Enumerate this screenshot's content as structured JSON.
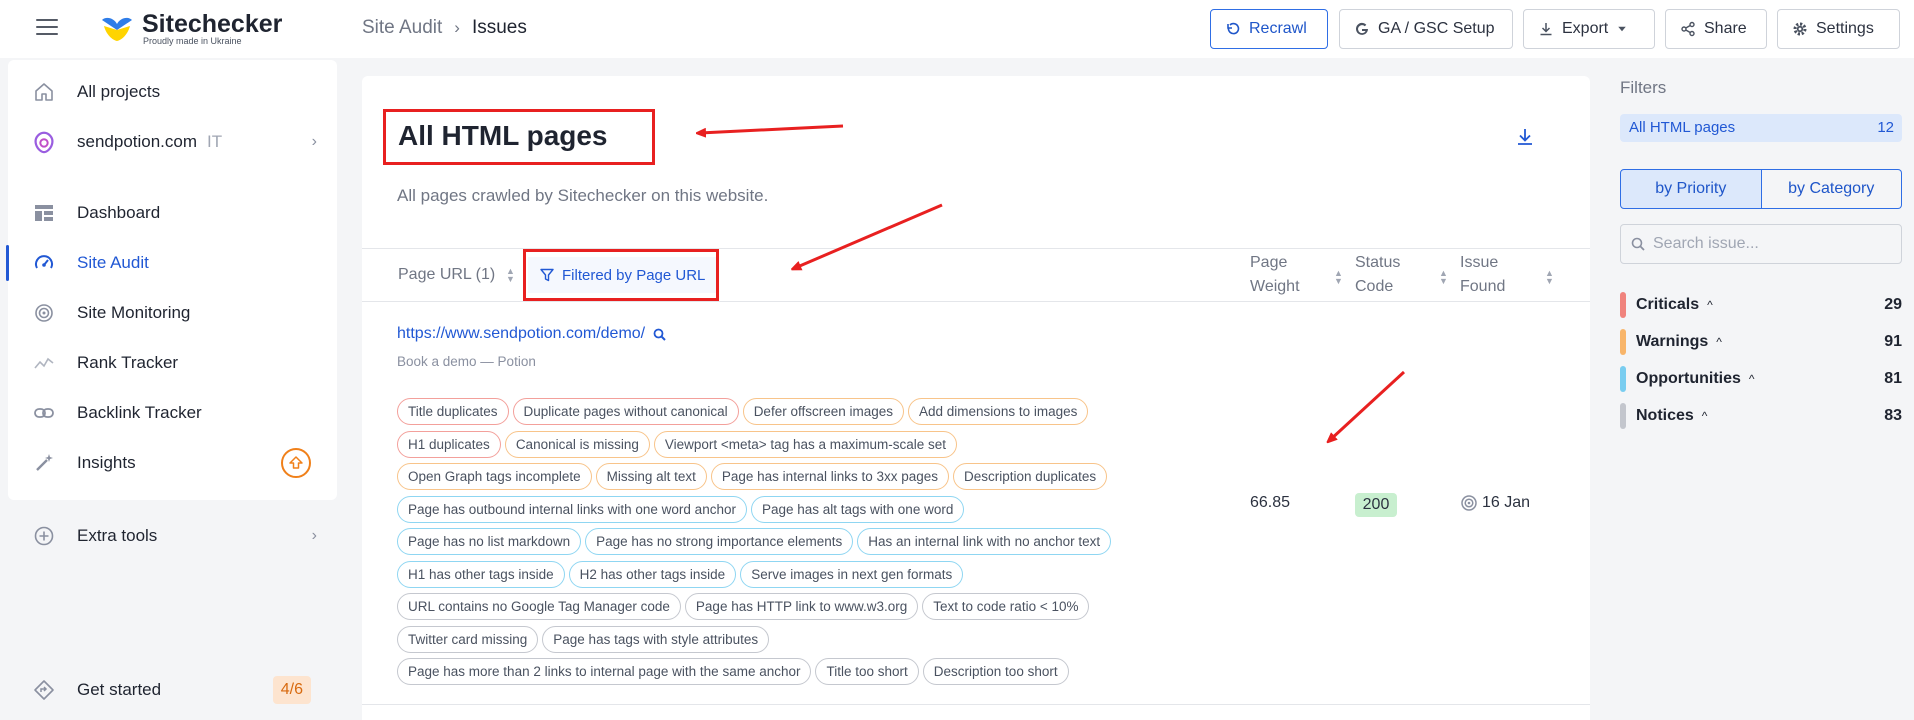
{
  "logo": {
    "name": "Sitechecker",
    "tagline": "Proudly made in Ukraine"
  },
  "breadcrumb": {
    "parent": "Site Audit",
    "separator": "›",
    "current": "Issues"
  },
  "toolbar": {
    "recrawl": "Recrawl",
    "ga_gsc": "GA / GSC Setup",
    "export": "Export",
    "share": "Share",
    "settings": "Settings"
  },
  "sidebar": {
    "all_projects": "All projects",
    "project_domain": "sendpotion.com",
    "project_tag": "IT",
    "items": [
      {
        "label": "Dashboard"
      },
      {
        "label": "Site Audit"
      },
      {
        "label": "Site Monitoring"
      },
      {
        "label": "Rank Tracker"
      },
      {
        "label": "Backlink Tracker"
      },
      {
        "label": "Insights"
      }
    ],
    "extra_tools": "Extra tools",
    "get_started": "Get started",
    "get_started_progress": "4/6"
  },
  "main": {
    "title": "All HTML pages",
    "description": "All pages crawled by Sitechecker on this website.",
    "columns": {
      "page_url": "Page URL (1)",
      "filter_chip": "Filtered by Page URL",
      "page_weight_1": "Page",
      "page_weight_2": "Weight",
      "status_code_1": "Status",
      "status_code_2": "Code",
      "issue_found_1": "Issue",
      "issue_found_2": "Found"
    },
    "row": {
      "url": "https://www.sendpotion.com/demo/",
      "page_title": "Book a demo — Potion",
      "page_weight": "66.85",
      "status_code": "200",
      "issue_found": "16 Jan"
    },
    "tag_lines": [
      [
        {
          "label": "Title duplicates",
          "level": "critical"
        },
        {
          "label": "Duplicate pages without canonical",
          "level": "critical"
        },
        {
          "label": "Defer offscreen images",
          "level": "warning"
        },
        {
          "label": "Add dimensions to images",
          "level": "warning"
        }
      ],
      [
        {
          "label": "H1 duplicates",
          "level": "critical"
        },
        {
          "label": "Canonical is missing",
          "level": "warning"
        },
        {
          "label": "Viewport <meta> tag has a maximum-scale set",
          "level": "warning"
        }
      ],
      [
        {
          "label": "Open Graph tags incomplete",
          "level": "warning"
        },
        {
          "label": "Missing alt text",
          "level": "warning"
        },
        {
          "label": "Page has internal links to 3xx pages",
          "level": "warning"
        },
        {
          "label": "Description duplicates",
          "level": "warning"
        }
      ],
      [
        {
          "label": "Page has outbound internal links with one word anchor",
          "level": "opportunity"
        },
        {
          "label": "Page has alt tags with one word",
          "level": "opportunity"
        }
      ],
      [
        {
          "label": "Page has no list markdown",
          "level": "opportunity"
        },
        {
          "label": "Page has no strong importance elements",
          "level": "opportunity"
        },
        {
          "label": "Has an internal link with no anchor text",
          "level": "opportunity"
        }
      ],
      [
        {
          "label": "H1 has other tags inside",
          "level": "opportunity"
        },
        {
          "label": "H2 has other tags inside",
          "level": "opportunity"
        },
        {
          "label": "Serve images in next gen formats",
          "level": "opportunity"
        }
      ],
      [
        {
          "label": "URL contains no Google Tag Manager code",
          "level": "notice"
        },
        {
          "label": "Page has HTTP link to www.w3.org",
          "level": "notice"
        },
        {
          "label": "Text to code ratio < 10%",
          "level": "notice"
        }
      ],
      [
        {
          "label": "Twitter card missing",
          "level": "notice"
        },
        {
          "label": "Page has tags with style attributes",
          "level": "notice"
        }
      ],
      [
        {
          "label": "Page has more than 2 links to internal page with the same anchor",
          "level": "notice"
        },
        {
          "label": "Title too short",
          "level": "notice"
        },
        {
          "label": "Description too short",
          "level": "notice"
        }
      ]
    ]
  },
  "filters": {
    "title": "Filters",
    "all_label": "All HTML pages",
    "all_count": "12",
    "by_priority": "by Priority",
    "by_category": "by Category",
    "search_placeholder": "Search issue...",
    "categories": [
      {
        "label": "Criticals",
        "count": "29",
        "color": "#f0837d"
      },
      {
        "label": "Warnings",
        "count": "91",
        "color": "#f8b56a"
      },
      {
        "label": "Opportunities",
        "count": "81",
        "color": "#79cdf0"
      },
      {
        "label": "Notices",
        "count": "83",
        "color": "#c3c6cd"
      }
    ]
  },
  "colors": {
    "accent": "#2158d4",
    "annotation": "#e82020",
    "status_ok": "#c8efcf"
  },
  "icons": {
    "recrawl": "refresh-icon",
    "ga_gsc": "google-icon",
    "export": "download-icon",
    "share": "share-icon",
    "settings": "gear-icon"
  }
}
